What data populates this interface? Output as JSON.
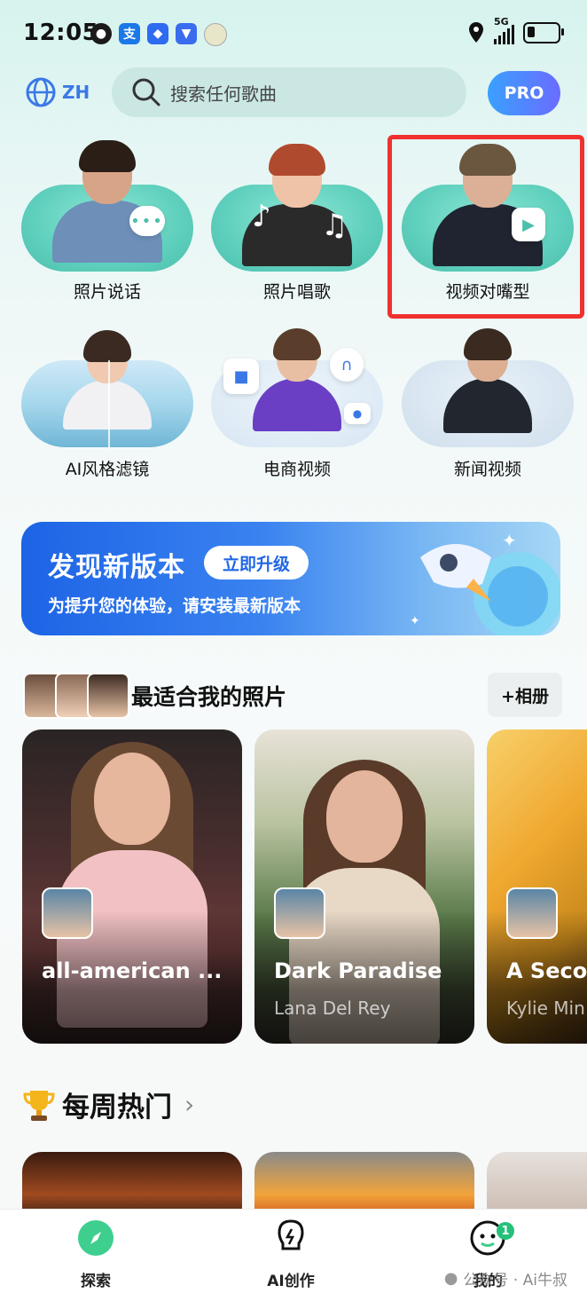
{
  "status_bar": {
    "time": "12:05",
    "network": "5G"
  },
  "header": {
    "language": "ZH",
    "search_placeholder": "搜索任何歌曲",
    "pro_label": "PRO"
  },
  "features": [
    {
      "label": "照片说话"
    },
    {
      "label": "照片唱歌"
    },
    {
      "label": "视频对嘴型"
    },
    {
      "label": "AI风格滤镜"
    },
    {
      "label": "电商视频"
    },
    {
      "label": "新闻视频"
    }
  ],
  "banner": {
    "title": "发现新版本",
    "button": "立即升级",
    "subtitle": "为提升您的体验，请安装最新版本"
  },
  "photos_section": {
    "title": "最适合我的照片",
    "album_button": "+相册"
  },
  "cards": [
    {
      "title": "all-american ...",
      "subtitle": ""
    },
    {
      "title": "Dark Paradise",
      "subtitle": "Lana Del Rey"
    },
    {
      "title": "A Secor",
      "subtitle": "Kylie Min"
    }
  ],
  "weekly": {
    "title": "每周热门",
    "chevron": "›"
  },
  "nav": [
    {
      "label": "探索"
    },
    {
      "label": "AI创作"
    },
    {
      "label": "我的",
      "badge": "1"
    }
  ],
  "watermark": "公众号 · Ai牛叔",
  "colors": {
    "accent_blue": "#2167e4",
    "highlight_red": "#f0312f",
    "nav_green": "#27c07b"
  }
}
